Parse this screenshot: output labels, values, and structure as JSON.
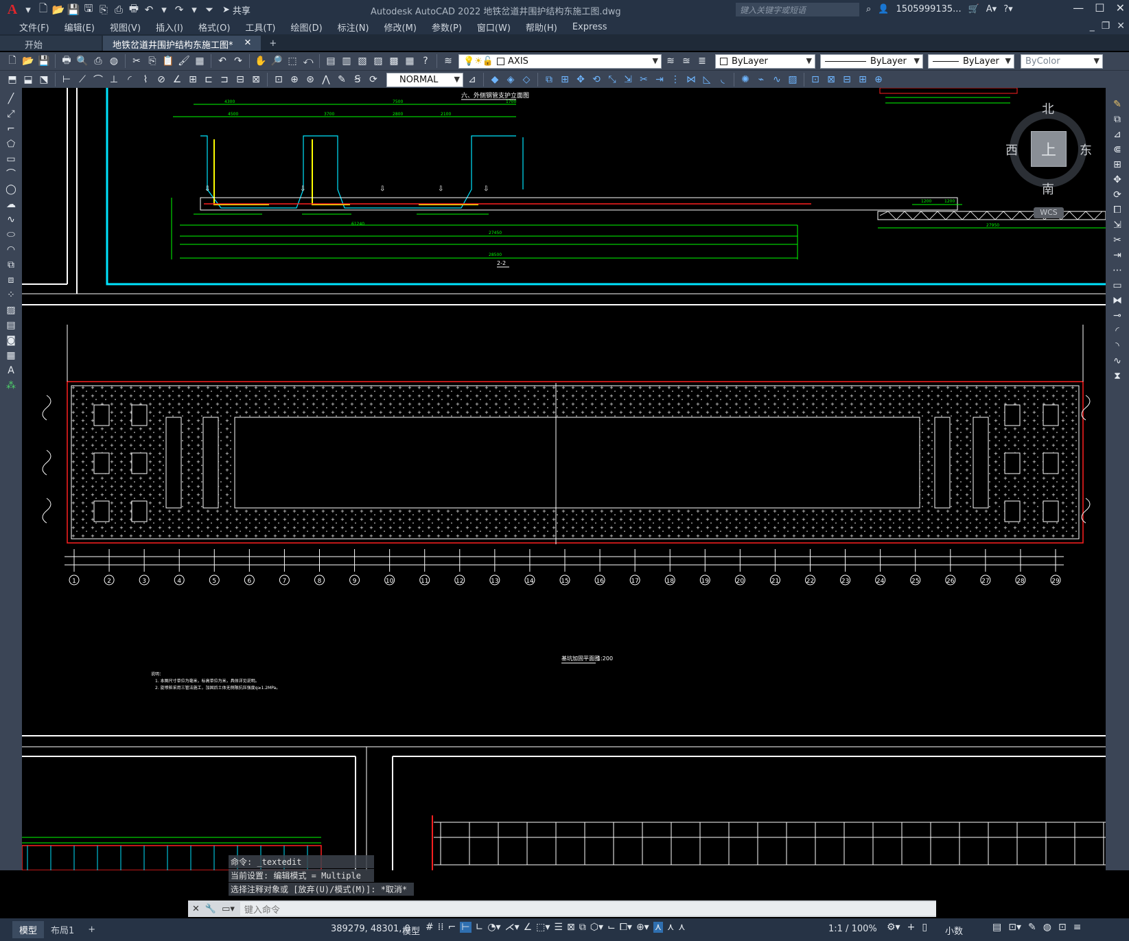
{
  "app": {
    "window_title": "Autodesk AutoCAD 2022    地铁岔道井围护结构东施工图.dwg",
    "share_label": "共享",
    "search_placeholder": "键入关键字或短语",
    "user": "1505999135...",
    "logo": "A"
  },
  "menu": [
    "文件(F)",
    "编辑(E)",
    "视图(V)",
    "插入(I)",
    "格式(O)",
    "工具(T)",
    "绘图(D)",
    "标注(N)",
    "修改(M)",
    "参数(P)",
    "窗口(W)",
    "帮助(H)",
    "Express"
  ],
  "tabs": {
    "start": "开始",
    "active": "地铁岔道井围护结构东施工图*",
    "close": "✕",
    "add": "+"
  },
  "toolbar1": {
    "layer": "AXIS",
    "color": "ByLayer",
    "linetype": "ByLayer",
    "lineweight": "ByLayer",
    "plotstyle": "ByColor"
  },
  "toolbar2": {
    "dimstyle": "NORMAL"
  },
  "viewcube": {
    "north": "北",
    "south": "南",
    "west": "西",
    "east": "东",
    "top": "上",
    "wcs": "WCS"
  },
  "drawing": {
    "section_title": "六、外侧钢管支护立面图",
    "section_label": "2-2",
    "plan_title": "基坑加固平面图",
    "plan_scale": "1:200",
    "notes_title": "说明：",
    "notes": [
      "1. 本图尺寸单位为毫米，标高单位为米，具体详见说明。",
      "2. 旋喷桩采用三管法施工，加固后土体无侧限抗压强度q≥1.2MPa。"
    ],
    "axis_numbers": [
      "1",
      "2",
      "3",
      "4",
      "5",
      "6",
      "7",
      "8",
      "9",
      "10",
      "11",
      "12",
      "13",
      "14",
      "15",
      "16",
      "17",
      "18",
      "19",
      "20",
      "21",
      "22",
      "23",
      "24",
      "25",
      "26",
      "27",
      "28",
      "29"
    ],
    "dims": [
      "4300",
      "7500",
      "1700",
      "4500",
      "3700",
      "2800",
      "2100",
      "27450",
      "28500",
      "61240",
      "27950",
      "1200",
      "1200"
    ]
  },
  "command": {
    "history": [
      "命令: _textedit",
      "当前设置: 编辑模式 = Multiple",
      "选择注释对象或 [放弃(U)/模式(M)]: *取消*"
    ],
    "input_placeholder": "键入命令"
  },
  "status": {
    "layout_tabs": [
      "模型",
      "布局1"
    ],
    "add_layout": "+",
    "coords": "389279, 48301, 0",
    "model": "模型",
    "scale": "1:1 / 100%",
    "units": "小数"
  }
}
